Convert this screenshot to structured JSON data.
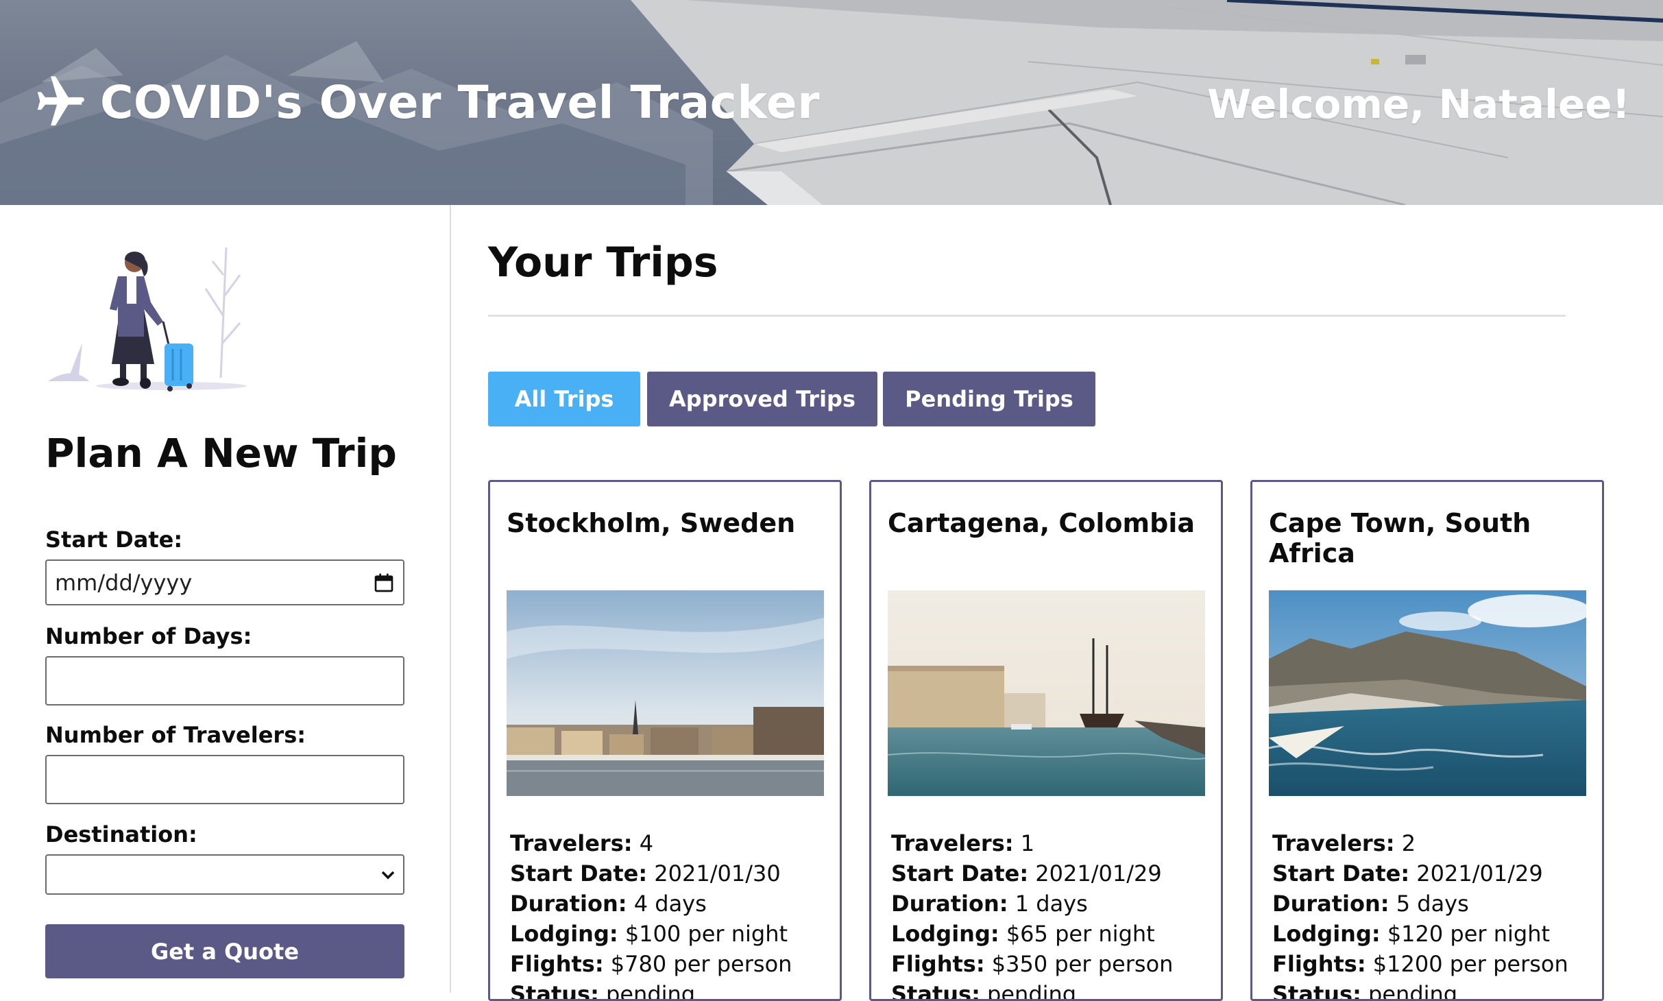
{
  "header": {
    "app_title": "COVID's Over Travel Tracker",
    "logo_icon": "airplane-icon",
    "welcome": "Welcome, Natalee!"
  },
  "sidebar": {
    "title": "Plan A New Trip",
    "start_date": {
      "label": "Start Date:",
      "placeholder": "mm/dd/yyyy"
    },
    "days": {
      "label": "Number of Days:",
      "value": ""
    },
    "travelers": {
      "label": "Number of Travelers:",
      "value": ""
    },
    "destination": {
      "label": "Destination:",
      "value": ""
    },
    "quote_button": "Get a Quote"
  },
  "main": {
    "title": "Your Trips",
    "tabs": [
      {
        "label": "All Trips",
        "active": true
      },
      {
        "label": "Approved Trips",
        "active": false
      },
      {
        "label": "Pending Trips",
        "active": false
      }
    ],
    "trips": [
      {
        "destination": "Stockholm, Sweden",
        "travelers_label": "Travelers:",
        "travelers": "4",
        "start_label": "Start Date:",
        "start": "2021/01/30",
        "duration_label": "Duration:",
        "duration": "4 days",
        "lodging_label": "Lodging:",
        "lodging": "$100 per night",
        "flights_label": "Flights:",
        "flights": "$780 per person",
        "status_label": "Status:",
        "status": "pending"
      },
      {
        "destination": "Cartagena, Colombia",
        "travelers_label": "Travelers:",
        "travelers": "1",
        "start_label": "Start Date:",
        "start": "2021/01/29",
        "duration_label": "Duration:",
        "duration": "1 days",
        "lodging_label": "Lodging:",
        "lodging": "$65 per night",
        "flights_label": "Flights:",
        "flights": "$350 per person",
        "status_label": "Status:",
        "status": "pending"
      },
      {
        "destination": "Cape Town, South Africa",
        "travelers_label": "Travelers:",
        "travelers": "2",
        "start_label": "Start Date:",
        "start": "2021/01/29",
        "duration_label": "Duration:",
        "duration": "5 days",
        "lodging_label": "Lodging:",
        "lodging": "$120 per night",
        "flights_label": "Flights:",
        "flights": "$1200 per person",
        "status_label": "Status:",
        "status": "pending"
      }
    ]
  },
  "colors": {
    "primary": "#5b5986",
    "active_tab": "#4ab0f5",
    "header_bg": "#6f798b"
  }
}
